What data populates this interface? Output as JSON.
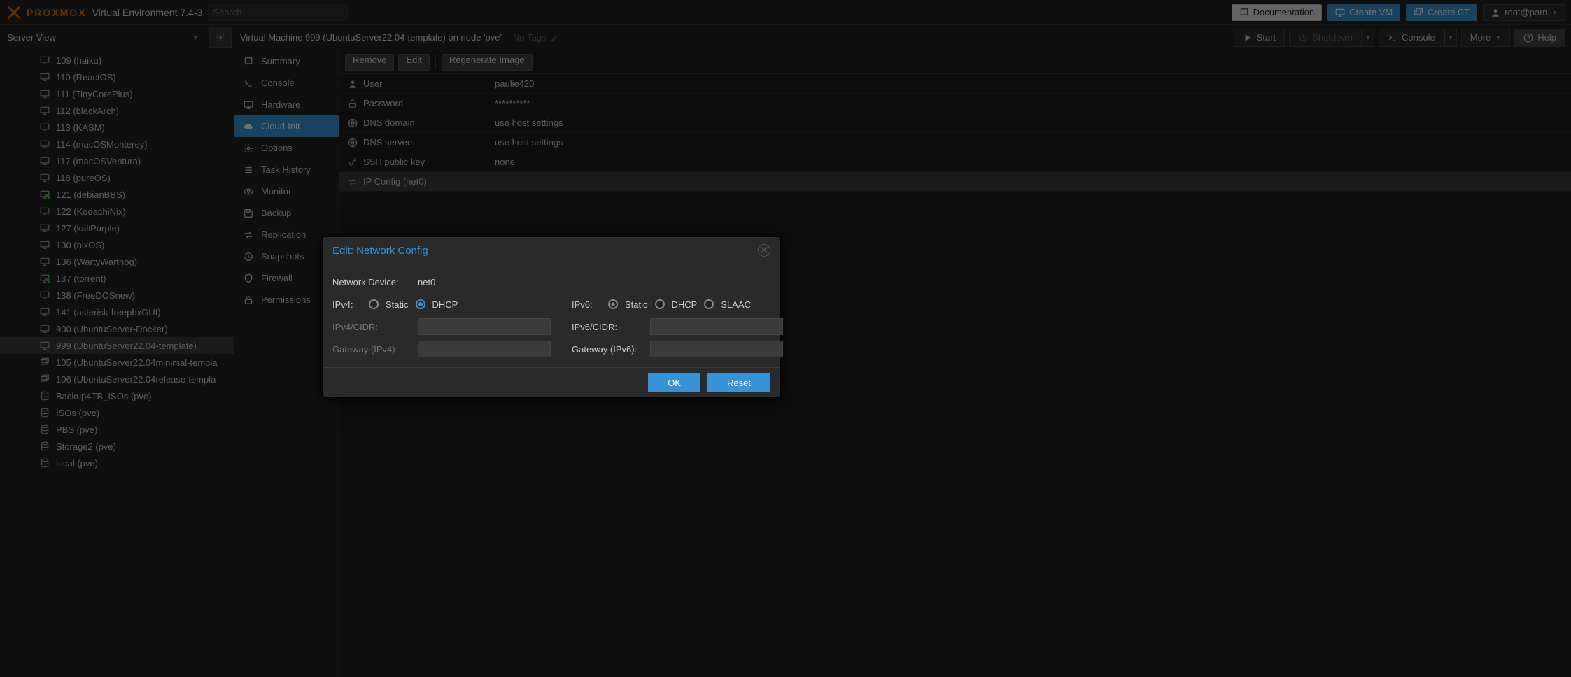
{
  "header": {
    "brand": "PROXMOX",
    "env_label": "Virtual Environment 7.4-3",
    "search_placeholder": "Search",
    "doc_label": "Documentation",
    "create_vm_label": "Create VM",
    "create_ct_label": "Create CT",
    "user_label": "root@pam"
  },
  "subbar": {
    "server_view_label": "Server View",
    "context_title": "Virtual Machine 999 (UbuntuServer22.04-template) on node 'pve'",
    "no_tags": "No Tags",
    "start": "Start",
    "shutdown": "Shutdown",
    "console": "Console",
    "more": "More",
    "help": "Help"
  },
  "tree": [
    {
      "icon": "monitor",
      "label": "109 (haiku)"
    },
    {
      "icon": "monitor",
      "label": "110 (ReactOS)"
    },
    {
      "icon": "monitor",
      "label": "111 (TinyCorePlus)"
    },
    {
      "icon": "monitor",
      "label": "112 (blackArch)"
    },
    {
      "icon": "monitor",
      "label": "113 (KASM)"
    },
    {
      "icon": "monitor",
      "label": "114 (macOSMonterey)"
    },
    {
      "icon": "monitor",
      "label": "117 (macOSVentura)"
    },
    {
      "icon": "monitor",
      "label": "118 (pureOS)"
    },
    {
      "icon": "monitor-on",
      "label": "121 (debianBBS)"
    },
    {
      "icon": "monitor",
      "label": "122 (KodachiNix)"
    },
    {
      "icon": "monitor",
      "label": "127 (kaliPurple)"
    },
    {
      "icon": "monitor",
      "label": "130 (nixOS)"
    },
    {
      "icon": "monitor",
      "label": "136 (WartyWarthog)"
    },
    {
      "icon": "monitor-on",
      "label": "137 (torrent)"
    },
    {
      "icon": "monitor",
      "label": "138 (FreeDOSnew)"
    },
    {
      "icon": "monitor",
      "label": "141 (asterisk-freepbxGUI)"
    },
    {
      "icon": "monitor",
      "label": "900 (UbuntuServer-Docker)"
    },
    {
      "icon": "monitor",
      "label": "999 (UbuntuServer22.04-template)",
      "selected": true
    },
    {
      "icon": "template",
      "label": "105 (UbuntuServer22.04minimal-templa"
    },
    {
      "icon": "template",
      "label": "106 (UbuntuServer22.04release-templa"
    },
    {
      "icon": "disks",
      "label": "Backup4TB_ISOs (pve)"
    },
    {
      "icon": "disks",
      "label": "ISOs (pve)"
    },
    {
      "icon": "disks",
      "label": "PBS (pve)"
    },
    {
      "icon": "disks",
      "label": "Storage2 (pve)"
    },
    {
      "icon": "disks",
      "label": "local (pve)"
    }
  ],
  "nav": [
    {
      "icon": "book",
      "label": "Summary"
    },
    {
      "icon": "terminal",
      "label": "Console"
    },
    {
      "icon": "monitor",
      "label": "Hardware"
    },
    {
      "icon": "cloud",
      "label": "Cloud-Init",
      "active": true
    },
    {
      "icon": "gear",
      "label": "Options"
    },
    {
      "icon": "list",
      "label": "Task History"
    },
    {
      "icon": "eye",
      "label": "Monitor"
    },
    {
      "icon": "save",
      "label": "Backup"
    },
    {
      "icon": "replication",
      "label": "Replication"
    },
    {
      "icon": "history",
      "label": "Snapshots"
    },
    {
      "icon": "shield",
      "label": "Firewall"
    },
    {
      "icon": "unlock",
      "label": "Permissions"
    }
  ],
  "grid_toolbar": {
    "remove": "Remove",
    "edit": "Edit",
    "regenerate": "Regenerate Image"
  },
  "grid": [
    {
      "icon": "user",
      "key": "User",
      "val": "paulie420"
    },
    {
      "icon": "unlock",
      "key": "Password",
      "val": "**********"
    },
    {
      "icon": "globe",
      "key": "DNS domain",
      "val": "use host settings"
    },
    {
      "icon": "globe",
      "key": "DNS servers",
      "val": "use host settings"
    },
    {
      "icon": "key",
      "key": "SSH public key",
      "val": "none"
    },
    {
      "icon": "exchange",
      "key": "IP Config (net0)",
      "val": "",
      "selected": true
    }
  ],
  "modal": {
    "title": "Edit: Network Config",
    "device_label": "Network Device:",
    "device_value": "net0",
    "ipv4_label": "IPv4:",
    "static_label": "Static",
    "dhcp_label": "DHCP",
    "ipv4_cidr_label": "IPv4/CIDR:",
    "gw4_label": "Gateway (IPv4):",
    "ipv6_label": "IPv6:",
    "slaac_label": "SLAAC",
    "ipv6_cidr_label": "IPv6/CIDR:",
    "gw6_label": "Gateway (IPv6):",
    "ipv4_mode": "dhcp",
    "ipv6_mode": "static",
    "ok": "OK",
    "reset": "Reset"
  }
}
